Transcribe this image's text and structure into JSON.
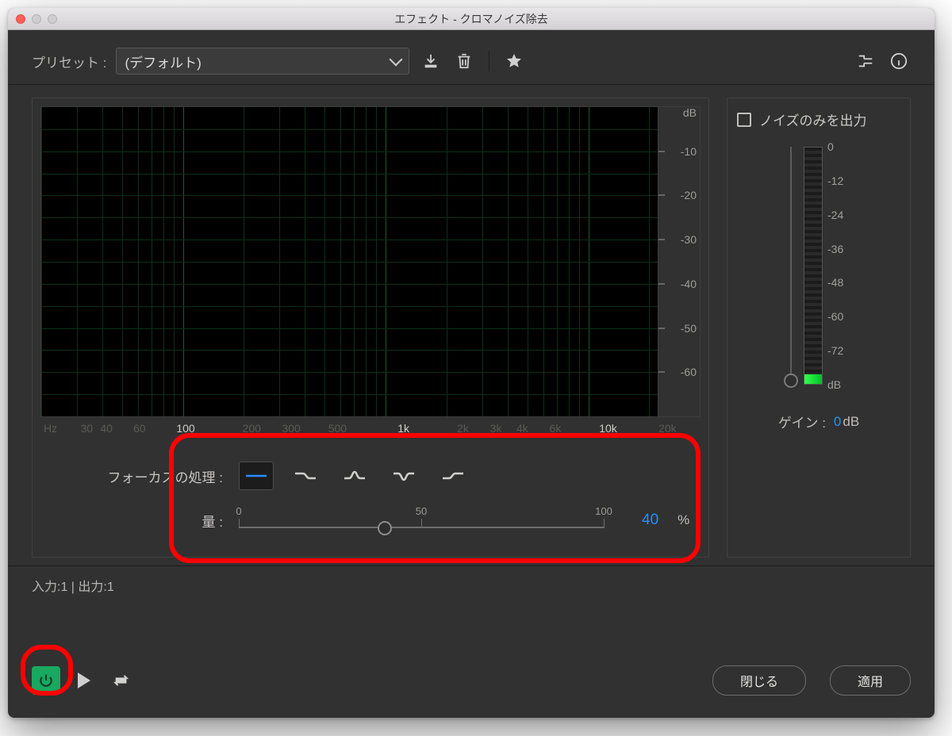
{
  "window": {
    "title": "エフェクト - クロマノイズ除去"
  },
  "header": {
    "preset_label": "プリセット :",
    "preset_value": "(デフォルト)"
  },
  "spectrum": {
    "db_unit": "dB",
    "db_ticks": [
      "-10",
      "-20",
      "-30",
      "-40",
      "-50",
      "-60"
    ],
    "hz_unit": "Hz",
    "hz_ticks": [
      {
        "label": "30",
        "major": false
      },
      {
        "label": "40",
        "major": false
      },
      {
        "label": "60",
        "major": false
      },
      {
        "label": "100",
        "major": true
      },
      {
        "label": "200",
        "major": false
      },
      {
        "label": "300",
        "major": false
      },
      {
        "label": "500",
        "major": false
      },
      {
        "label": "1k",
        "major": true
      },
      {
        "label": "2k",
        "major": false
      },
      {
        "label": "3k",
        "major": false
      },
      {
        "label": "4k",
        "major": false
      },
      {
        "label": "6k",
        "major": false
      },
      {
        "label": "10k",
        "major": true
      },
      {
        "label": "20k",
        "major": false
      }
    ]
  },
  "right": {
    "checkbox_label": "ノイズのみを出力",
    "meter_scale": [
      "0",
      "-12",
      "-24",
      "-36",
      "-48",
      "-60",
      "-72",
      "dB"
    ],
    "gain_label": "ゲイン :",
    "gain_value": "0",
    "gain_unit": "dB"
  },
  "focus": {
    "label": "フォーカスの処理 :",
    "options": [
      "flat",
      "shelf-low",
      "peak",
      "notch",
      "shelf-high"
    ],
    "selected": 0
  },
  "amount": {
    "label": "量 :",
    "scale": [
      "0",
      "50",
      "100"
    ],
    "value": "40",
    "unit": "%",
    "position_pct": 40
  },
  "io": {
    "text": "入力:1 | 出力:1"
  },
  "footer": {
    "close": "閉じる",
    "apply": "適用"
  },
  "colors": {
    "accent": "#288cff",
    "power": "#18a85f",
    "highlight": "#ff0000"
  }
}
